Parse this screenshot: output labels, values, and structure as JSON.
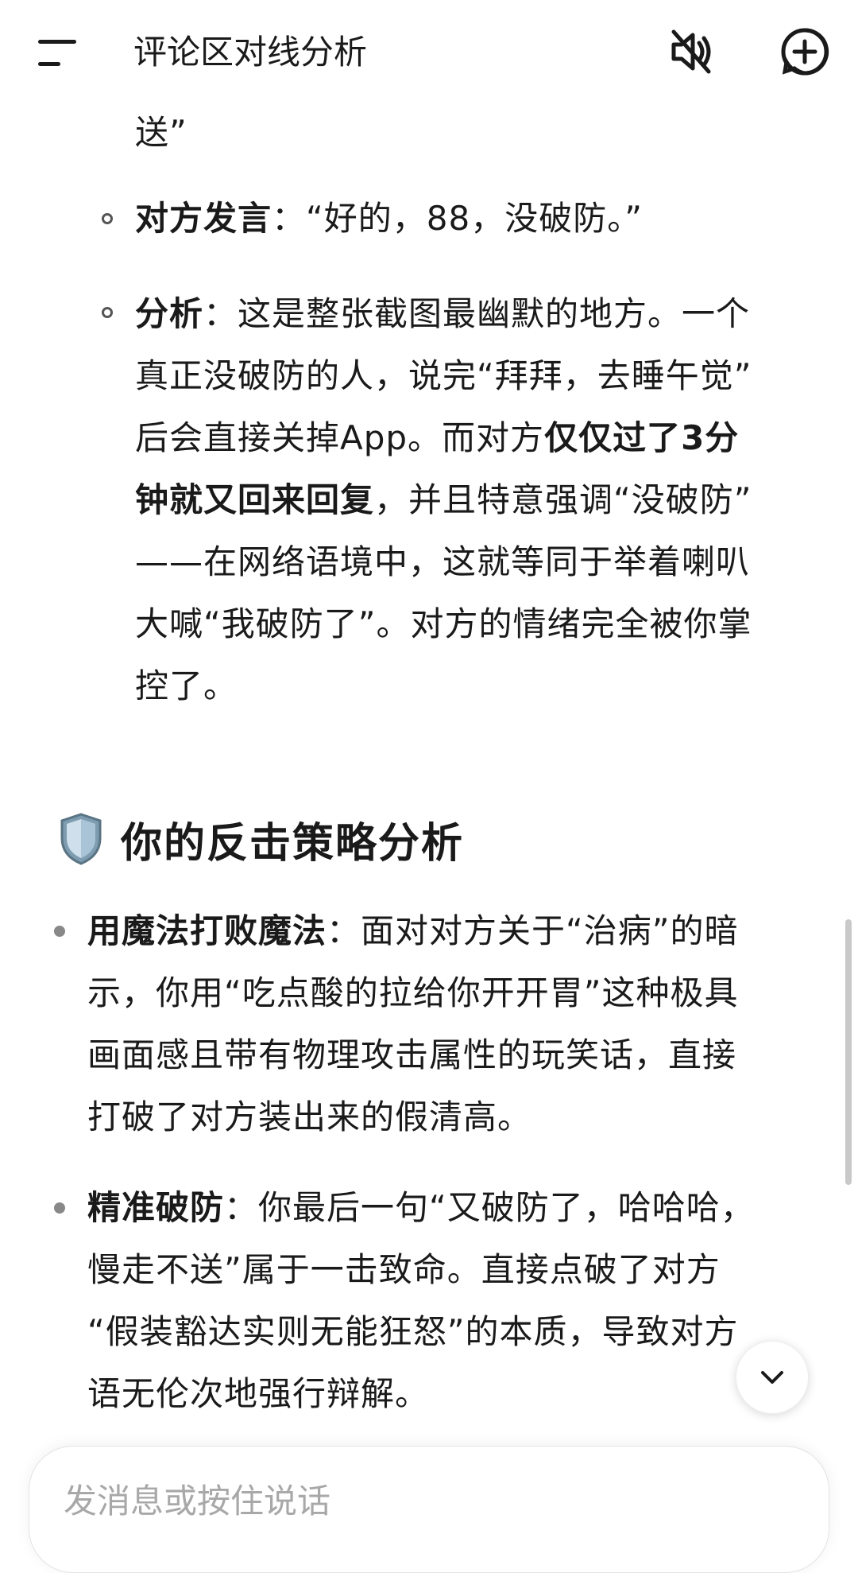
{
  "header": {
    "title": "评论区对线分析",
    "icons": {
      "menu": "menu-icon",
      "mute": "speaker-muted-icon",
      "new_chat": "plus-circle-icon"
    }
  },
  "content": {
    "continuation": "送”",
    "sub_items": [
      {
        "label": "对方发言",
        "text": "：“好的，88，没破防。”"
      },
      {
        "label": "分析",
        "lines": [
          "：这是整张截图最幽默的地方。一个",
          "真正没破防的人，说完“拜拜，去睡午觉”",
          "后会直接关掉App。而对方",
          "仅仅过了3分",
          "钟就又回来回复",
          "，并且特意强调“没破防”",
          "——在网络语境中，这就等同于举着喇叭",
          "大喊“我破防了”。对方的情绪完全被你掌",
          "控了。"
        ]
      }
    ],
    "section_title": "你的反击策略分析",
    "section_icon": "shield-icon",
    "main_items": [
      {
        "label": "用魔法打败魔法",
        "lines": [
          "：面对对方关于“治病”的暗",
          "示，你用“吃点酸的拉给你开开胃”这种极具",
          "画面感且带有物理攻击属性的玩笑话，直接",
          "打破了对方装出来的假清高。"
        ]
      },
      {
        "label": "精准破防",
        "lines": [
          "：你最后一句“又破防了，哈哈哈，",
          "慢走不送”属于一击致命。直接点破了对方",
          "“假装豁达实则无能狂怒”的本质，导致对方",
          "语无伦次地强行辩解。"
        ]
      }
    ]
  },
  "input": {
    "placeholder": "发消息或按住说话"
  },
  "colors": {
    "text": "#1a1a1a",
    "placeholder": "#a8a8a8",
    "bullet": "#888888"
  }
}
